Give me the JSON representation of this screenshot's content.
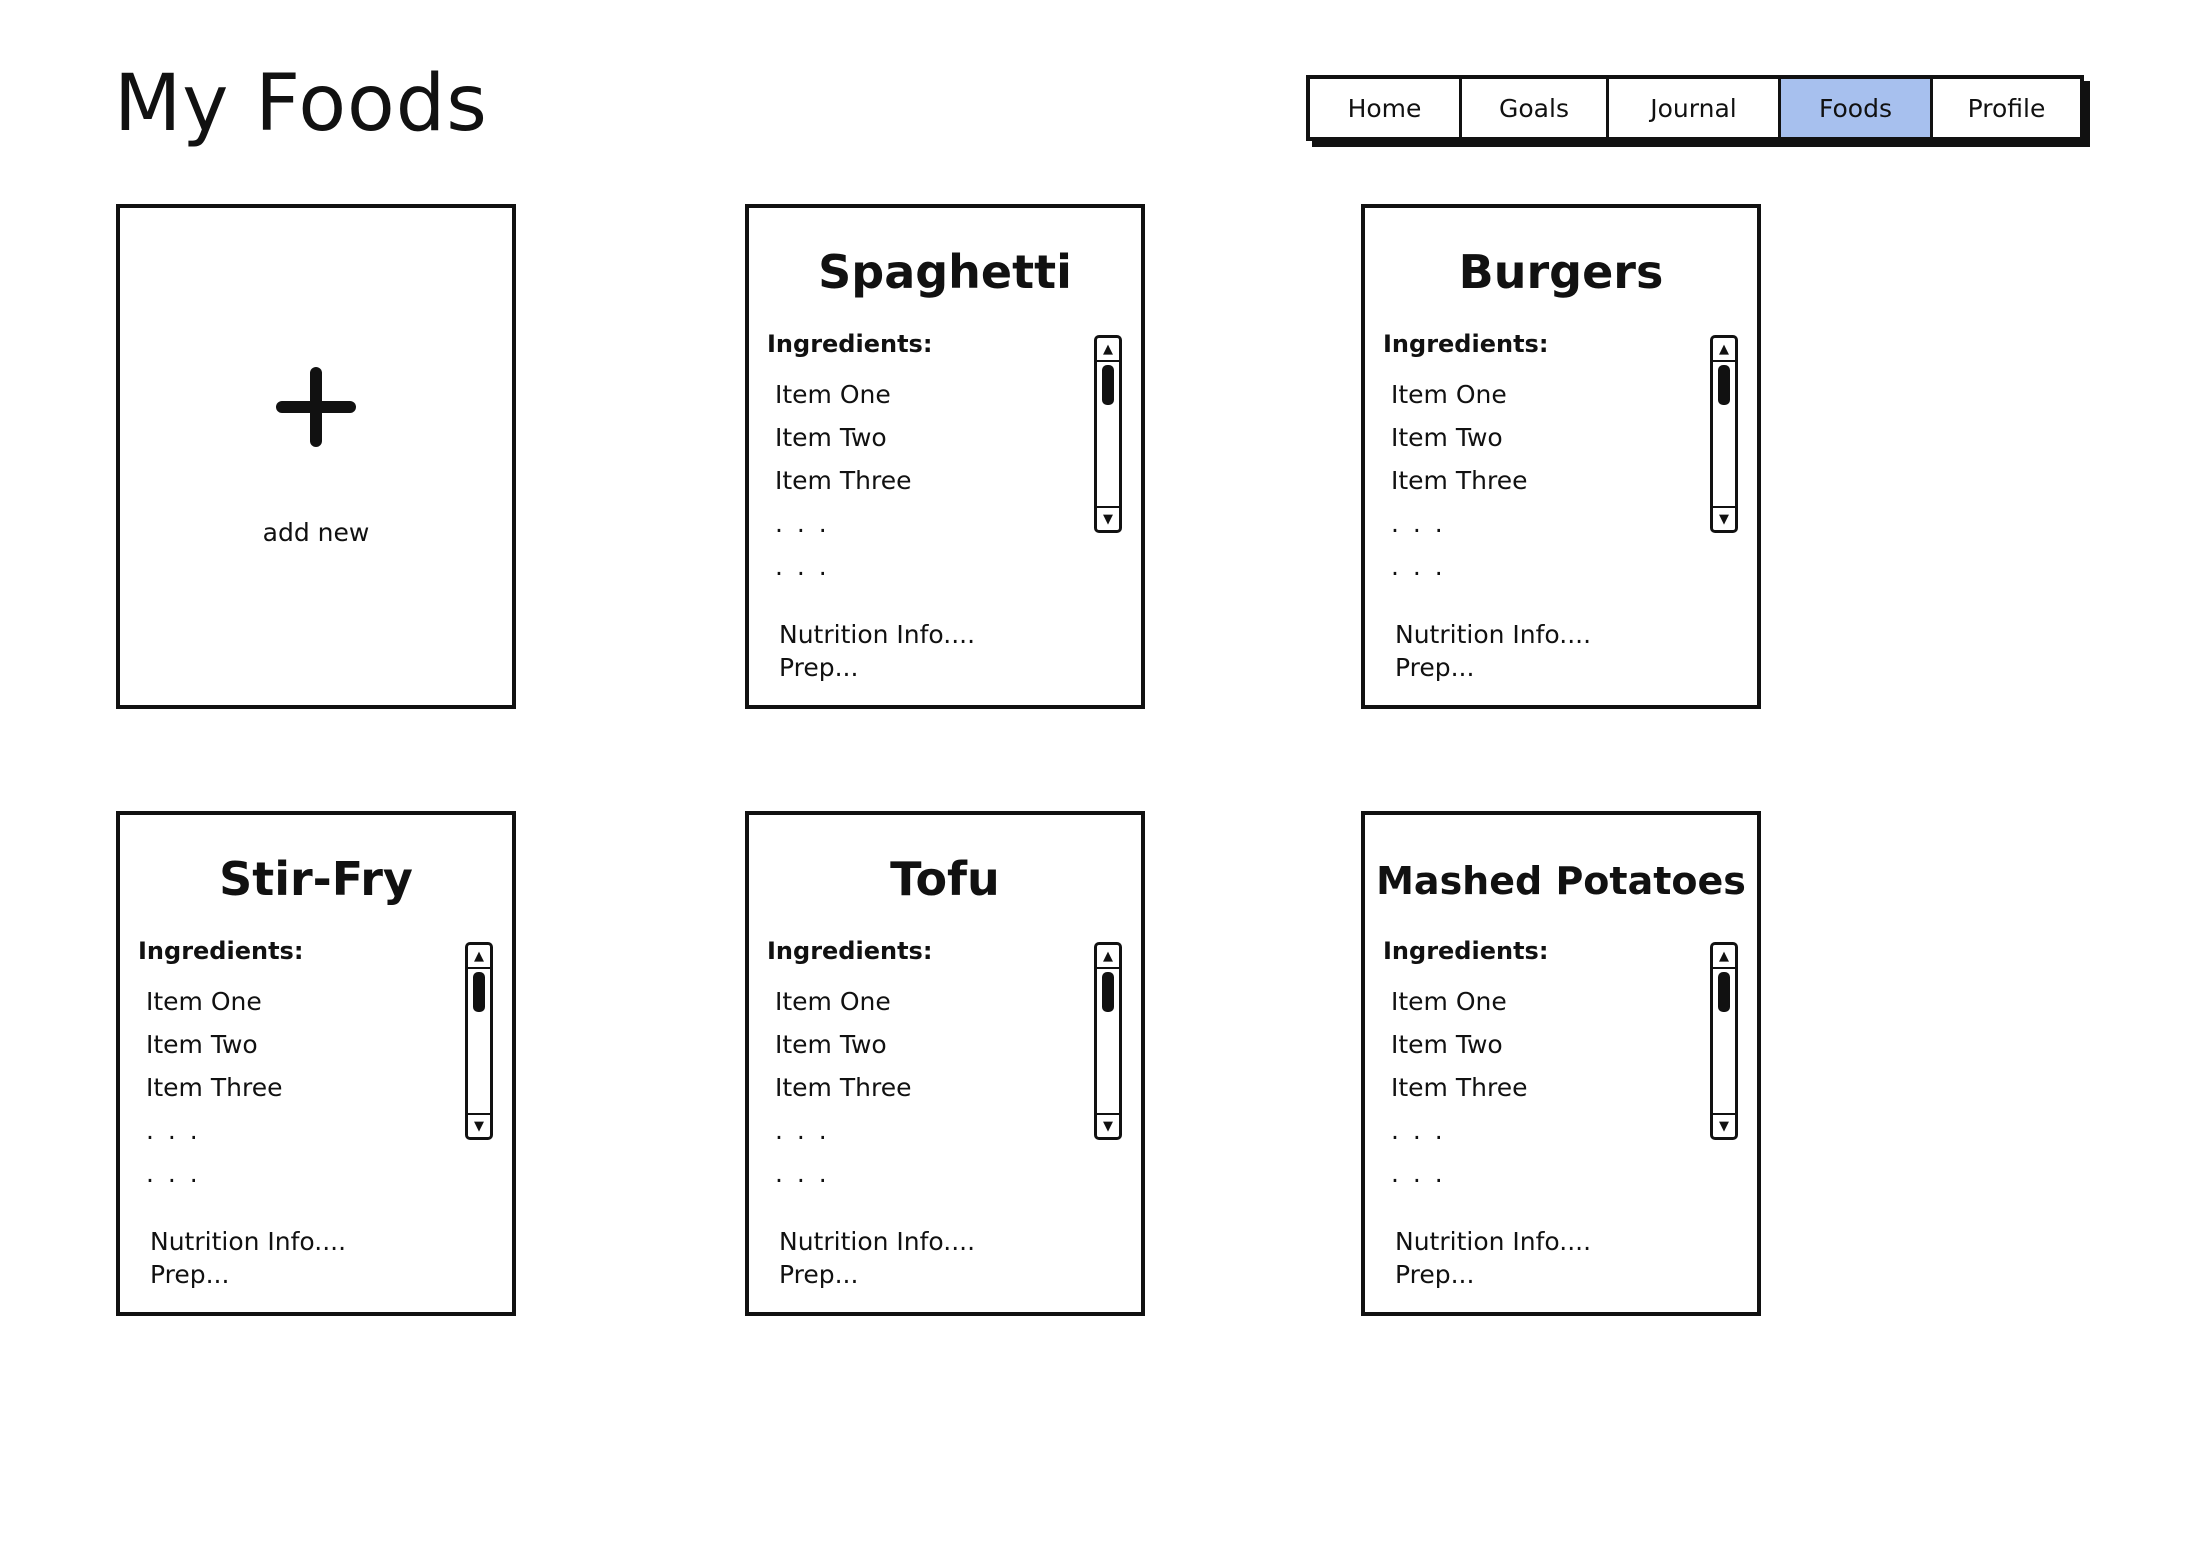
{
  "page": {
    "title": "My Foods"
  },
  "nav": {
    "items": [
      "Home",
      "Goals",
      "Journal",
      "Foods",
      "Profile"
    ],
    "active": "Foods",
    "active_color": "#a7c0ee"
  },
  "add_card": {
    "icon": "plus-icon",
    "label": "add new"
  },
  "foods": [
    {
      "title": "Spaghetti",
      "ingredients_label": "Ingredients:",
      "ingredients": [
        "Item One",
        "Item Two",
        "Item Three",
        ". . .",
        ". . ."
      ],
      "nutrition": "Nutrition Info....",
      "prep": "Prep..."
    },
    {
      "title": "Burgers",
      "ingredients_label": "Ingredients:",
      "ingredients": [
        "Item One",
        "Item Two",
        "Item Three",
        ". . .",
        ". . ."
      ],
      "nutrition": "Nutrition Info....",
      "prep": "Prep..."
    },
    {
      "title": "Stir-Fry",
      "ingredients_label": "Ingredients:",
      "ingredients": [
        "Item One",
        "Item Two",
        "Item Three",
        ". . .",
        ". . ."
      ],
      "nutrition": "Nutrition Info....",
      "prep": "Prep..."
    },
    {
      "title": "Tofu",
      "ingredients_label": "Ingredients:",
      "ingredients": [
        "Item One",
        "Item Two",
        "Item Three",
        ". . .",
        ". . ."
      ],
      "nutrition": "Nutrition Info....",
      "prep": "Prep..."
    },
    {
      "title": "Mashed Potatoes",
      "ingredients_label": "Ingredients:",
      "ingredients": [
        "Item One",
        "Item Two",
        "Item Three",
        ". . .",
        ". . ."
      ],
      "nutrition": "Nutrition Info....",
      "prep": "Prep..."
    }
  ]
}
